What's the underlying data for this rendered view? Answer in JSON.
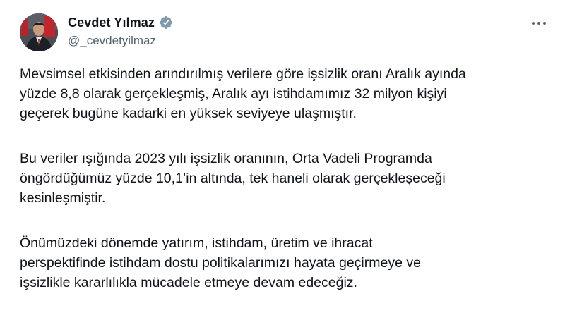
{
  "author": {
    "display_name": "Cevdet Yılmaz",
    "handle": "@_cevdetyilmaz",
    "verified_badge_color": "#829aab"
  },
  "icons": {
    "avatar": "profile-photo",
    "verified": "verified-badge-icon",
    "more": "more-options-icon"
  },
  "tweet": {
    "paragraphs": [
      "Mevsimsel etkisinden arındırılmış verilere göre işsizlik oranı Aralık ayında\nyüzde 8,8 olarak gerçekleşmiş, Aralık ayı istihdamımız 32 milyon kişiyi\ngeçerek bugüne kadarki en yüksek seviyeye ulaşmıştır.",
      "Bu veriler ışığında 2023 yılı işsizlik oranının, Orta Vadeli Programda\nöngördüğümüz yüzde 10,1’in altında, tek haneli olarak gerçekleşeceği\nkesinleşmiştir.",
      "Önümüzdeki dönemde yatırım, istihdam, üretim ve ihracat\nperspektifinde istihdam dostu politikalarımızı hayata geçirmeye ve\nişsizlikle kararlılıkla mücadele etmeye devam edeceğiz."
    ]
  }
}
